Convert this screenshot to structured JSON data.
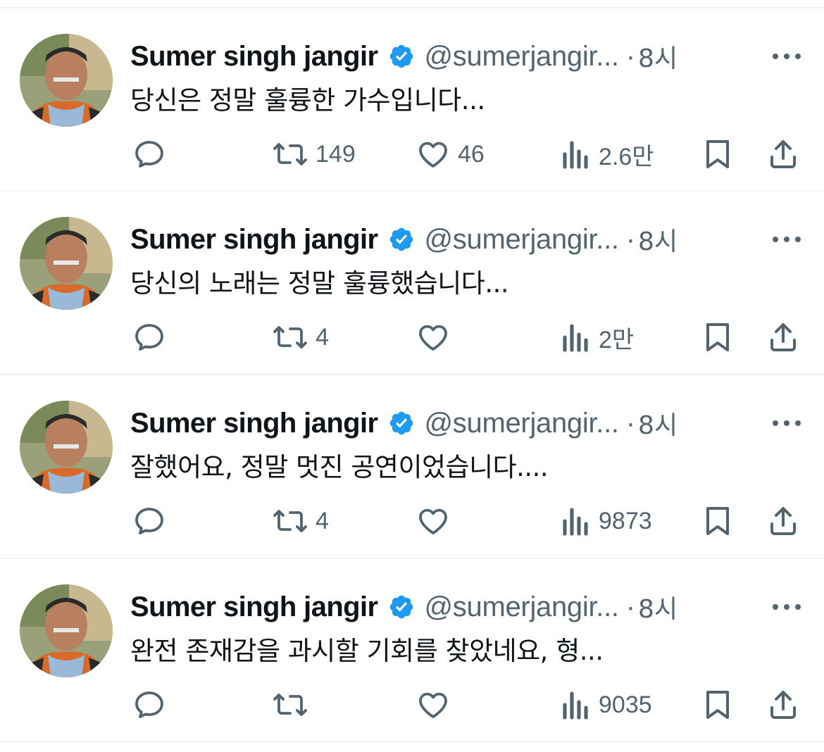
{
  "tweets": [
    {
      "name": "Sumer singh jangir",
      "handle": "@sumerjangir...",
      "separator": "·",
      "time": "8시",
      "text": "당신은 정말 훌륭한 가수입니다...",
      "reposts": "149",
      "likes": "46",
      "views": "2.6만"
    },
    {
      "name": "Sumer singh jangir",
      "handle": "@sumerjangir...",
      "separator": "·",
      "time": "8시",
      "text": "당신의 노래는 정말 훌륭했습니다...",
      "reposts": "4",
      "likes": "",
      "views": "2만"
    },
    {
      "name": "Sumer singh jangir",
      "handle": "@sumerjangir...",
      "separator": "·",
      "time": "8시",
      "text": "잘했어요, 정말 멋진 공연이었습니다....",
      "reposts": "4",
      "likes": "",
      "views": "9873"
    },
    {
      "name": "Sumer singh jangir",
      "handle": "@sumerjangir...",
      "separator": "·",
      "time": "8시",
      "text": "완전 존재감을 과시할 기회를 찾았네요, 형...",
      "reposts": "",
      "likes": "",
      "views": "9035"
    }
  ],
  "icons": {
    "verified": "verified-badge-icon",
    "more": "more-dots-icon",
    "reply": "reply-icon",
    "repost": "repost-icon",
    "like": "heart-icon",
    "views": "views-bar-chart-icon",
    "bookmark": "bookmark-icon",
    "share": "share-icon"
  },
  "colors": {
    "text": "#0f1419",
    "secondary": "#536471",
    "verified": "#1d9bf0",
    "divider": "#eff3f4"
  }
}
